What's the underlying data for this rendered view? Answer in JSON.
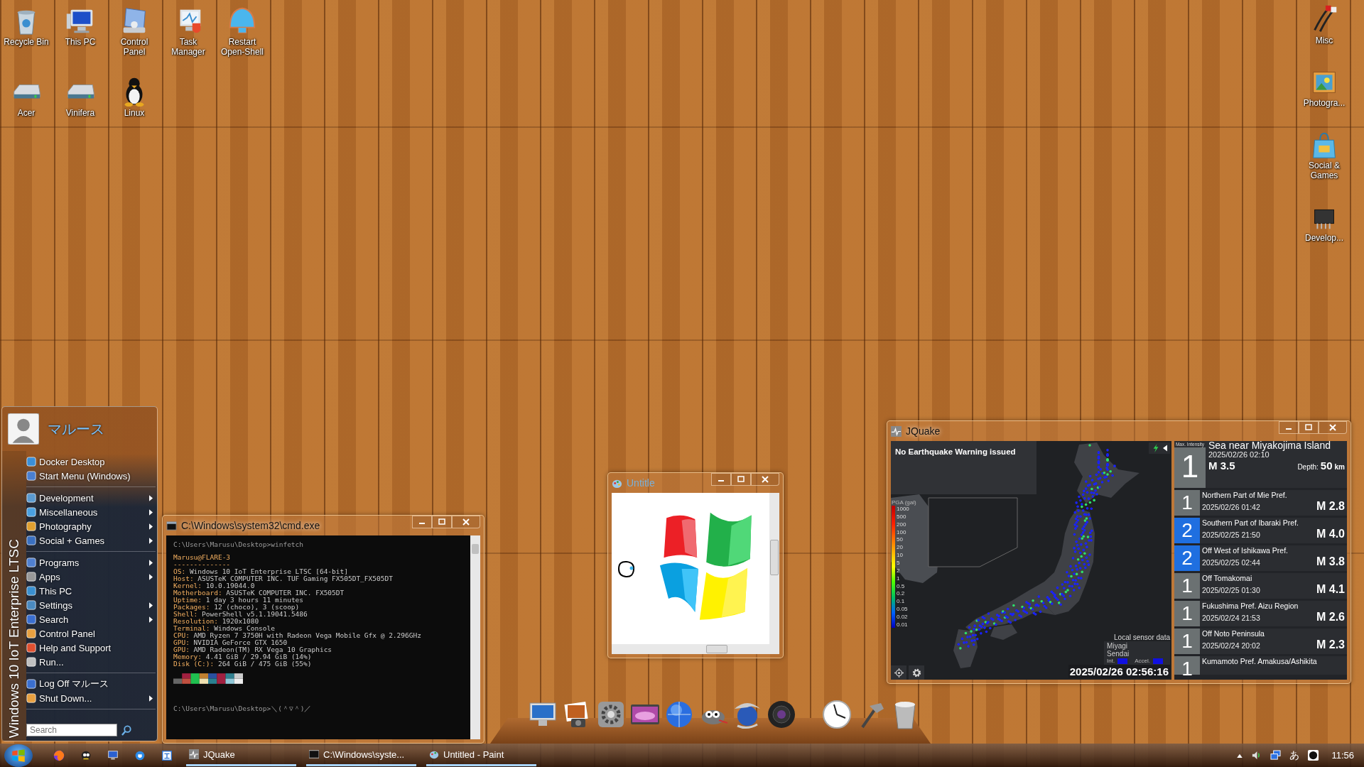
{
  "desktop_icons": [
    {
      "label": "Recycle Bin"
    },
    {
      "label": "This PC"
    },
    {
      "label": "Control Panel"
    },
    {
      "label": "Task Manager"
    },
    {
      "label": "Restart Open-Shell"
    },
    {
      "label": "Acer"
    },
    {
      "label": "Vinifera"
    },
    {
      "label": "Linux"
    }
  ],
  "right_icons": [
    {
      "label": "Misc"
    },
    {
      "label": "Photogra..."
    },
    {
      "label": "Social & Games"
    },
    {
      "label": "Develop..."
    }
  ],
  "start_menu": {
    "user": "マルース",
    "side_text": "Windows 10 IoT Enterprise LTSC",
    "sections": [
      {
        "items": [
          {
            "label": "Docker Desktop",
            "submenu": false
          },
          {
            "label": "Start Menu (Windows)",
            "submenu": false
          }
        ]
      },
      {
        "items": [
          {
            "label": "Development",
            "submenu": true
          },
          {
            "label": "Miscellaneous",
            "submenu": true
          },
          {
            "label": "Photography",
            "submenu": true
          },
          {
            "label": "Social + Games",
            "submenu": true
          }
        ]
      },
      {
        "items": [
          {
            "label": "Programs",
            "submenu": true
          },
          {
            "label": "Apps",
            "submenu": true
          },
          {
            "label": "This PC",
            "submenu": false
          },
          {
            "label": "Settings",
            "submenu": true
          },
          {
            "label": "Search",
            "submenu": true
          },
          {
            "label": "Control Panel",
            "submenu": false
          },
          {
            "label": "Help and Support",
            "submenu": false
          },
          {
            "label": "Run...",
            "submenu": false
          }
        ]
      },
      {
        "items": [
          {
            "label": "Log Off マルース",
            "submenu": false
          },
          {
            "label": "Shut Down...",
            "submenu": true
          }
        ]
      }
    ],
    "search": {
      "placeholder": "Search"
    }
  },
  "cmd": {
    "title": "C:\\Windows\\system32\\cmd.exe",
    "prompt": "C:\\Users\\Marusu\\Desktop>winfetch",
    "user_host": "Marusu@FLARE-3",
    "rule": "--------------",
    "info": [
      {
        "label": "OS:",
        "value": "Windows 10 IoT Enterprise LTSC [64-bit]"
      },
      {
        "label": "Host:",
        "value": "ASUSTeK COMPUTER INC. TUF Gaming FX505DT_FX505DT"
      },
      {
        "label": "Kernel:",
        "value": "10.0.19044.0"
      },
      {
        "label": "Motherboard:",
        "value": "ASUSTeK COMPUTER INC. FX505DT"
      },
      {
        "label": "Uptime:",
        "value": "1 day 3 hours 11 minutes"
      },
      {
        "label": "Packages:",
        "value": "12 (choco), 3 (scoop)"
      },
      {
        "label": "Shell:",
        "value": "PowerShell v5.1.19041.5486"
      },
      {
        "label": "Resolution:",
        "value": "1920x1080"
      },
      {
        "label": "Terminal:",
        "value": "Windows Console"
      },
      {
        "label": "CPU:",
        "value": "AMD Ryzen 7 3750H with Radeon Vega Mobile Gfx @ 2.296GHz"
      },
      {
        "label": "GPU:",
        "value": "NVIDIA GeForce GTX 1650"
      },
      {
        "label": "GPU:",
        "value": "AMD Radeon(TM) RX Vega 10 Graphics"
      },
      {
        "label": "Memory:",
        "value": "4.41 GiB / 29.94 GiB (14%)"
      },
      {
        "label": "Disk (C:):",
        "value": "264 GiB / 475 GiB (55%)"
      }
    ],
    "last_prompt": "C:\\Users\\Marusu\\Desktop>＼(＾▽＾)／"
  },
  "paint": {
    "title": "Untitle"
  },
  "jquake": {
    "title": "JQuake",
    "warning": "No Earthquake Warning issued",
    "legend": {
      "title": "PGA (gal)",
      "ticks": [
        "1000",
        "500",
        "200",
        "100",
        "50",
        "20",
        "10",
        "5",
        "2",
        "1",
        "0.5",
        "0.2",
        "0.1",
        "0.05",
        "0.02",
        "0.01"
      ]
    },
    "local_sensor": {
      "title": "Local sensor data",
      "region": "Miyagi",
      "city": "Sendai",
      "int_label": "Int.",
      "accel_label": "Accel."
    },
    "timestamp": "2025/02/26 02:56:16",
    "latest": {
      "label": "Max. Intensity",
      "intensity": "1",
      "location": "Sea near Miyakojima Island",
      "time": "2025/02/26 02:10",
      "magnitude": "M 3.5",
      "depth_label": "Depth:",
      "depth": "50",
      "depth_unit": "km"
    },
    "quakes": [
      {
        "intensity": "1",
        "color": "#6b7172",
        "location": "Northern Part of Mie Pref.",
        "time": "2025/02/26 01:42",
        "magnitude": "M 2.8"
      },
      {
        "intensity": "2",
        "color": "#1f6fe0",
        "location": "Southern Part of Ibaraki Pref.",
        "time": "2025/02/25 21:50",
        "magnitude": "M 4.0"
      },
      {
        "intensity": "2",
        "color": "#1f6fe0",
        "location": "Off West of Ishikawa Pref.",
        "time": "2025/02/25 02:44",
        "magnitude": "M 3.8"
      },
      {
        "intensity": "1",
        "color": "#6b7172",
        "location": "Off Tomakomai",
        "time": "2025/02/25 01:30",
        "magnitude": "M 4.1"
      },
      {
        "intensity": "1",
        "color": "#6b7172",
        "location": "Fukushima Pref. Aizu Region",
        "time": "2025/02/24 21:53",
        "magnitude": "M 2.6"
      },
      {
        "intensity": "1",
        "color": "#6b7172",
        "location": "Off Noto Peninsula",
        "time": "2025/02/24 20:02",
        "magnitude": "M 2.3"
      },
      {
        "intensity": "1",
        "color": "#6b7172",
        "location": "Kumamoto Pref. Amakusa/Ashikita"
      }
    ]
  },
  "taskbar": {
    "tasks": [
      {
        "label": "JQuake"
      },
      {
        "label": "C:\\Windows\\syste..."
      },
      {
        "label": "Untitled - Paint"
      }
    ],
    "ime": "あ",
    "clock": "11:56"
  }
}
